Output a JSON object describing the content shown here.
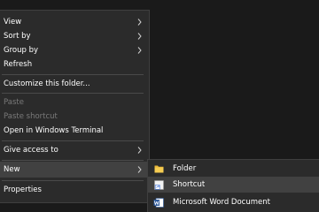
{
  "menu": {
    "items": [
      {
        "label": "View"
      },
      {
        "label": "Sort by"
      },
      {
        "label": "Group by"
      },
      {
        "label": "Refresh"
      },
      {
        "label": "Customize this folder..."
      },
      {
        "label": "Paste"
      },
      {
        "label": "Paste shortcut"
      },
      {
        "label": "Open in Windows Terminal"
      },
      {
        "label": "Give access to"
      },
      {
        "label": "New"
      },
      {
        "label": "Properties"
      }
    ]
  },
  "submenu": {
    "items": [
      {
        "label": "Folder",
        "icon": "folder-icon"
      },
      {
        "label": "Shortcut",
        "icon": "shortcut-icon"
      },
      {
        "label": "Microsoft Word Document",
        "icon": "word-icon"
      }
    ]
  },
  "colors": {
    "menu_bg": "#2b2b2b",
    "hover_bg": "#414141",
    "disabled_text": "#7a7a7a",
    "folder": "#e8b739",
    "word": "#2b579a"
  }
}
